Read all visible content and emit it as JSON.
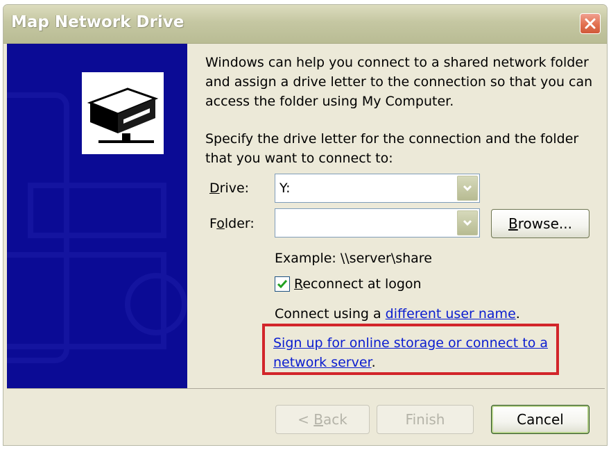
{
  "window": {
    "title": "Map Network Drive"
  },
  "intro": {
    "text": "Windows can help you connect to a shared network folder and assign a drive letter to the connection so that you can access the folder using My Computer."
  },
  "instruction": {
    "text": "Specify the drive letter for the connection and the folder that you want to connect to:"
  },
  "drive": {
    "label_prefix": "",
    "label_mnemonic": "D",
    "label_rest": "rive:",
    "value": "Y:"
  },
  "folder": {
    "label_prefix": "F",
    "label_mnemonic": "o",
    "label_rest": "lder:",
    "value": ""
  },
  "browse_button": {
    "label_mnemonic": "B",
    "label_rest": "rowse..."
  },
  "example": {
    "text": "Example: \\\\server\\share"
  },
  "reconnect": {
    "label_mnemonic": "R",
    "label_rest": "econnect at logon",
    "checked": true
  },
  "connect_using": {
    "prefix": "Connect using a ",
    "link_text": "different user name",
    "suffix": "."
  },
  "signup": {
    "link_line1": "Sign up for online storage or connect to a",
    "link_line2": "network server",
    "suffix": "."
  },
  "buttons": {
    "back_prefix": "< ",
    "back_mnemonic": "B",
    "back_rest": "ack",
    "finish": "Finish",
    "cancel": "Cancel"
  },
  "colors": {
    "banner_blue": "#0b0b95",
    "link_blue": "#0a1cd0",
    "highlight_red": "#d2252a"
  }
}
